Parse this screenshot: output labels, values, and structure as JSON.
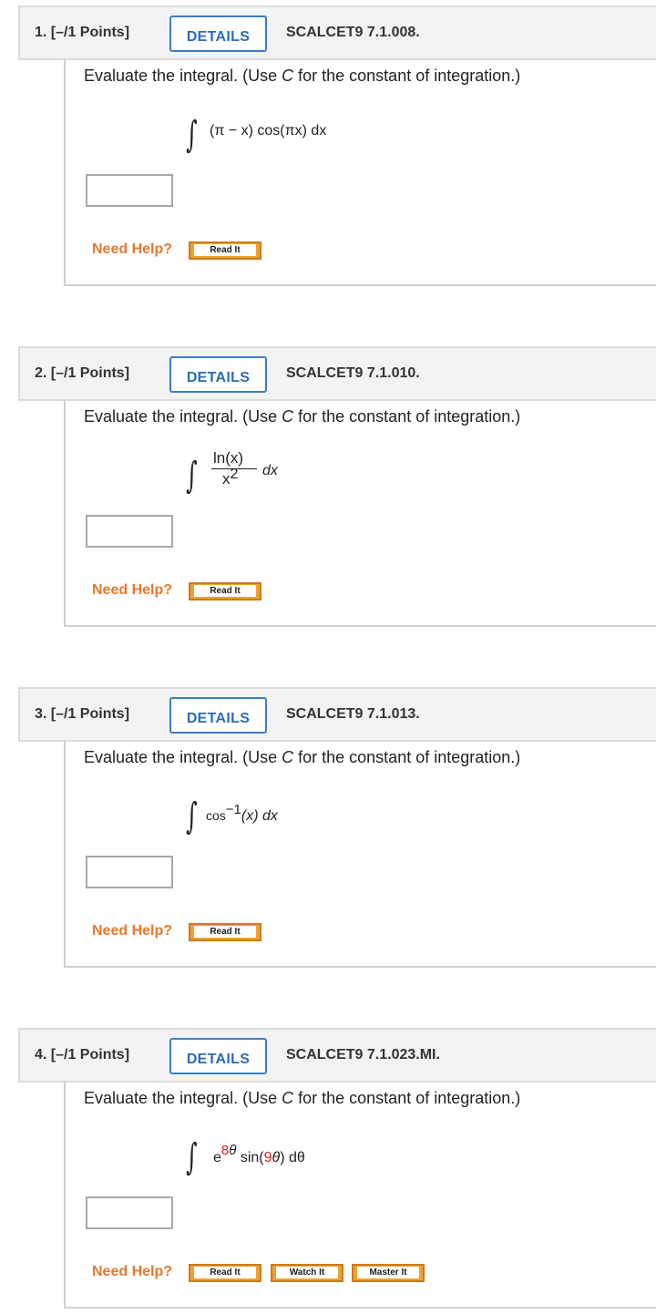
{
  "questions": [
    {
      "number": "1. [–/1 Points]",
      "details_label": "DETAILS",
      "id": "SCALCET9 7.1.008.",
      "prompt_pre": "Evaluate the integral. (Use ",
      "prompt_var": "C",
      "prompt_post": " for the constant of integration.)",
      "integrand": "(π − x) cos(πx) dx",
      "need_help": "Need Help?",
      "help_buttons": [
        "Read It"
      ]
    },
    {
      "number": "2. [–/1 Points]",
      "details_label": "DETAILS",
      "id": "SCALCET9 7.1.010.",
      "prompt_pre": "Evaluate the integral. (Use ",
      "prompt_var": "C",
      "prompt_post": " for the constant of integration.)",
      "integrand_numerator": "ln(x)",
      "integrand_denominator_base": "x",
      "integrand_denominator_exp": "2",
      "integrand_tail": "dx",
      "need_help": "Need Help?",
      "help_buttons": [
        "Read It"
      ]
    },
    {
      "number": "3. [–/1 Points]",
      "details_label": "DETAILS",
      "id": "SCALCET9 7.1.013.",
      "prompt_pre": "Evaluate the integral. (Use ",
      "prompt_var": "C",
      "prompt_post": " for the constant of integration.)",
      "integrand_func": "cos",
      "integrand_exp": "−1",
      "integrand_rest": "(x) dx",
      "need_help": "Need Help?",
      "help_buttons": [
        "Read It"
      ]
    },
    {
      "number": "4. [–/1 Points]",
      "details_label": "DETAILS",
      "id": "SCALCET9 7.1.023.MI.",
      "prompt_pre": "Evaluate the integral. (Use ",
      "prompt_var": "C",
      "prompt_post": " for the constant of integration.)",
      "integrand_base": "e",
      "integrand_exp_coef": "8",
      "integrand_exp_var": "θ",
      "integrand_fn": " sin(",
      "integrand_arg_coef": "9",
      "integrand_arg_var": "θ",
      "integrand_close": ") dθ",
      "need_help": "Need Help?",
      "help_buttons": [
        "Read It",
        "Watch It",
        "Master It"
      ]
    }
  ],
  "colors": {
    "details_blue": "#2c6db5",
    "need_help_orange": "#e7782c",
    "help_button_orange": "#f0a030",
    "highlight_red": "#e0191b"
  }
}
